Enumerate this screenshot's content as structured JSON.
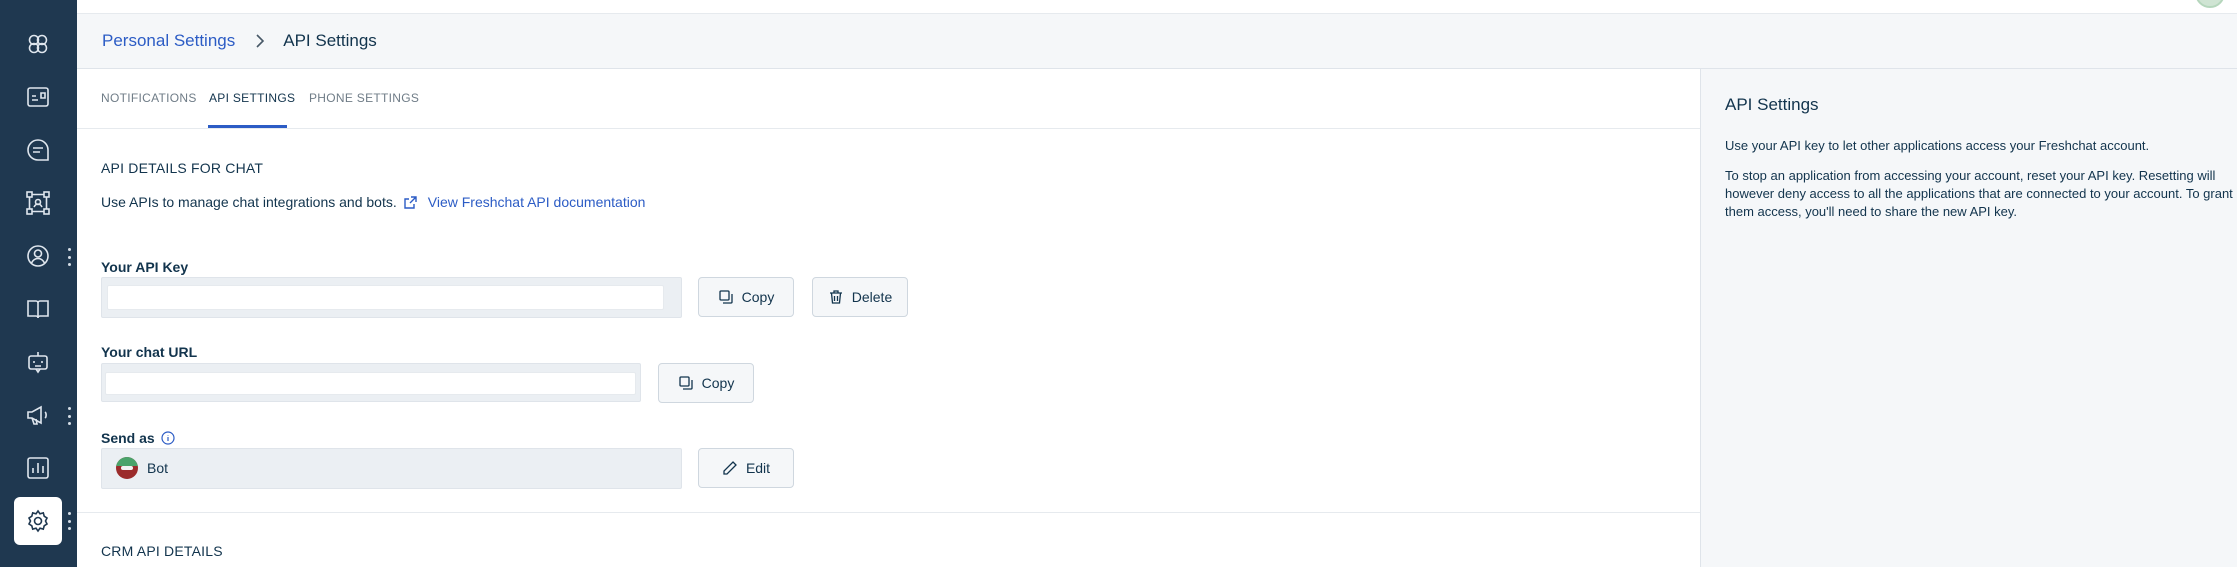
{
  "breadcrumb": {
    "parent": "Personal Settings",
    "current": "API Settings"
  },
  "tabs": [
    {
      "label": "NOTIFICATIONS",
      "active": false
    },
    {
      "label": "API SETTINGS",
      "active": true
    },
    {
      "label": "PHONE SETTINGS",
      "active": false
    }
  ],
  "chat_section": {
    "title": "API DETAILS FOR CHAT",
    "description": "Use APIs to manage chat integrations and bots.",
    "doc_link": "View Freshchat API documentation"
  },
  "api_key": {
    "label": "Your API Key",
    "value": "",
    "copy_label": "Copy",
    "delete_label": "Delete"
  },
  "chat_url": {
    "label": "Your chat URL",
    "value": "",
    "copy_label": "Copy"
  },
  "send_as": {
    "label": "Send as",
    "value": "Bot",
    "edit_label": "Edit"
  },
  "crm_section": {
    "title": "CRM API DETAILS"
  },
  "right_panel": {
    "title": "API Settings",
    "paragraph_1": "Use your API key to let other applications access your Freshchat account.",
    "paragraph_2": "To stop an application from accessing your account, reset your API key. Resetting will however deny access to all the applications that are connected to your account. To grant them access, you'll need to share the new API key."
  },
  "sidebar_icons": [
    "freshworks-logo-icon",
    "dashboard-icon",
    "chat-icon",
    "workflow-icon",
    "contacts-icon",
    "knowledge-base-icon",
    "bot-icon",
    "campaigns-icon",
    "reports-icon",
    "settings-icon"
  ],
  "colors": {
    "sidebar": "#1f3850",
    "accent": "#2c5cc5",
    "text": "#12344d"
  }
}
